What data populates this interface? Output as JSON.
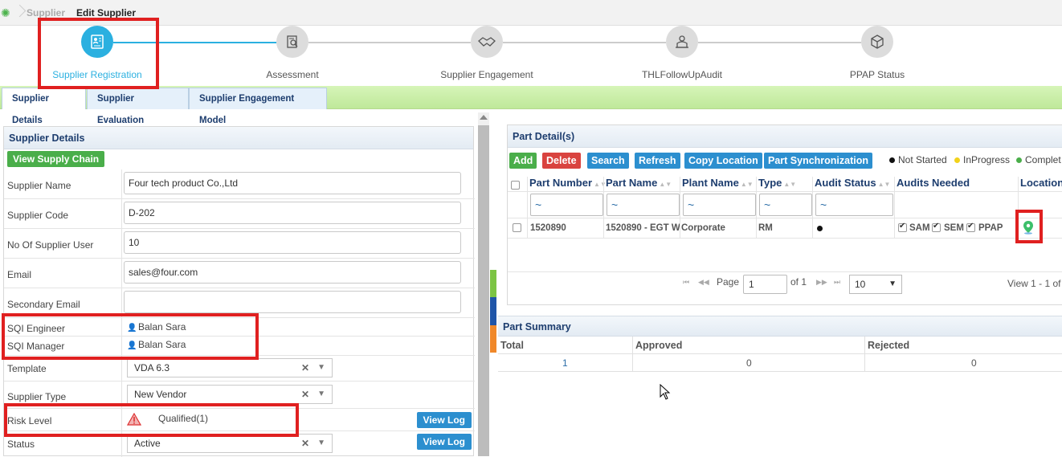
{
  "breadcrumb": {
    "parent": "Supplier",
    "current": "Edit Supplier"
  },
  "steps": [
    {
      "label": "Supplier Registration",
      "icon": "registration-icon",
      "active": true
    },
    {
      "label": "Assessment",
      "icon": "assessment-icon",
      "active": false
    },
    {
      "label": "Supplier Engagement",
      "icon": "handshake-icon",
      "active": false
    },
    {
      "label": "THLFollowUpAudit",
      "icon": "audit-icon",
      "active": false
    },
    {
      "label": "PPAP Status",
      "icon": "box-icon",
      "active": false
    }
  ],
  "tabs": [
    {
      "label": "Supplier Details",
      "active": true
    },
    {
      "label": "Supplier Evaluation",
      "active": false
    },
    {
      "label": "Supplier Engagement Model",
      "active": false
    }
  ],
  "supplier_details": {
    "title": "Supplier Details",
    "view_supply_chain": "View Supply Chain",
    "fields": {
      "supplier_name": {
        "label": "Supplier Name",
        "value": "Four tech product Co.,Ltd"
      },
      "supplier_code": {
        "label": "Supplier Code",
        "value": "D-202"
      },
      "no_of_users": {
        "label": "No Of Supplier User",
        "value": "10"
      },
      "email": {
        "label": "Email",
        "value": "sales@four.com"
      },
      "secondary_email": {
        "label": "Secondary Email",
        "value": ""
      },
      "sqi_engineer": {
        "label": "SQI Engineer",
        "value": "Balan Sara"
      },
      "sqi_manager": {
        "label": "SQI Manager",
        "value": "Balan Sara"
      },
      "template": {
        "label": "Template",
        "value": "VDA 6.3"
      },
      "supplier_type": {
        "label": "Supplier Type",
        "value": "New Vendor"
      },
      "risk_level": {
        "label": "Risk Level",
        "value": "Qualified(1)"
      },
      "status": {
        "label": "Status",
        "value": "Active"
      }
    },
    "view_log": "View Log"
  },
  "part_details": {
    "title": "Part Detail(s)",
    "buttons": {
      "add": "Add",
      "delete": "Delete",
      "search": "Search",
      "refresh": "Refresh",
      "copy_location": "Copy Location",
      "part_sync": "Part Synchronization"
    },
    "legend": {
      "not_started": "Not Started",
      "in_progress": "InProgress",
      "completed": "Complet"
    },
    "columns": [
      "Part Number",
      "Part Name",
      "Plant Name",
      "Type",
      "Audit Status",
      "Audits Needed",
      "Location"
    ],
    "filter_symbol": "~",
    "rows": [
      {
        "part_number": "1520890",
        "part_name": "1520890 - EGT W",
        "plant_name": "Corporate",
        "type": "RM",
        "audits": [
          "SAM",
          "SEM",
          "PPAP"
        ]
      }
    ],
    "pager": {
      "page_label": "Page",
      "page": "1",
      "of": "of 1",
      "page_size": "10",
      "view": "View 1 - 1 of"
    }
  },
  "part_summary": {
    "title": "Part Summary",
    "headers": {
      "total": "Total",
      "approved": "Approved",
      "rejected": "Rejected"
    },
    "values": {
      "total": "1",
      "approved": "0",
      "rejected": "0"
    }
  },
  "colors": {
    "accent": "#2bb0e0",
    "green": "#4aae4a",
    "blue": "#2c8fcf",
    "red": "#d9433f",
    "highlight": "#e02020"
  }
}
